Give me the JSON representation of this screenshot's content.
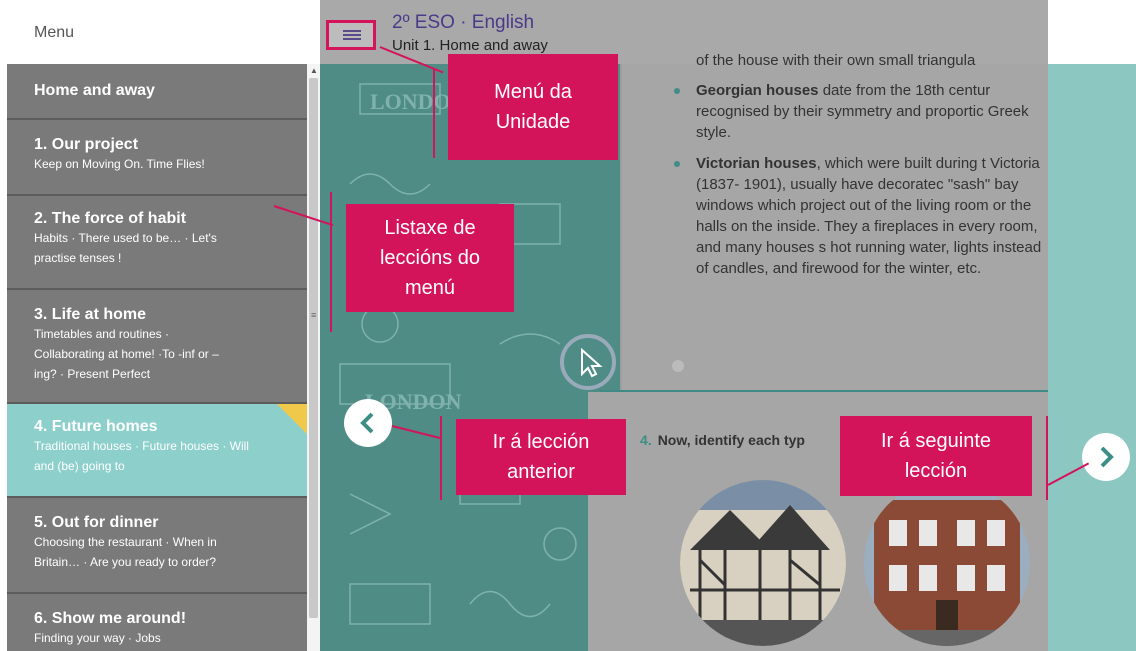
{
  "sidebar": {
    "menu_title": "Menu",
    "header_item": "Home and away",
    "items": [
      {
        "title": "1. Our project",
        "subtitle": "Keep on Moving On. Time Flies!"
      },
      {
        "title": "2. The force of habit",
        "subtitle": "Habits · There used to be… · Let's practise tenses !"
      },
      {
        "title": "3. Life at home",
        "subtitle": "Timetables and routines · Collaborating at home! ·To -inf or –ing? · Present Perfect"
      },
      {
        "title": "4. Future homes",
        "subtitle": "Traditional houses · Future houses · Will and (be) going to"
      },
      {
        "title": "5. Out for dinner",
        "subtitle": "Choosing the restaurant · When in Britain… · Are you ready to order?"
      },
      {
        "title": "6. Show me around!",
        "subtitle": "Finding your way · Jobs"
      }
    ],
    "active_index": 3
  },
  "header": {
    "title": "2º ESO · English",
    "subtitle": "Unit 1. Home and away"
  },
  "content": {
    "cut_line": "of the house with their own small triangula",
    "georgian_bold": "Georgian houses",
    "georgian_text": "date from the 18th centur recognised by their symmetry and proportic Greek style.",
    "victorian_bold": "Victorian houses",
    "victorian_text": ", which were built during t Victoria (1837- 1901), usually have decoratec \"sash\" bay windows which project out of the living room or the halls on the inside. They a fireplaces in every room, and many houses s hot running water, lights instead of candles, and firewood for the winter, etc.",
    "task_number": "4.",
    "task_text": "Now, identify each typ",
    "pattern_text": "LONDON"
  },
  "callouts": {
    "unit_menu": "Menú da\nUnidade",
    "lesson_list": "Listaxe de\nleccións do\nmenú",
    "prev": "Ir á lección\nanterior",
    "next": "Ir á seguinte\nlección"
  },
  "icons": {
    "menu": "hamburger-icon",
    "copy": "copy-icon",
    "search": "search-icon",
    "prev": "chevron-left-icon",
    "next": "chevron-right-icon",
    "cursor": "cursor-icon"
  },
  "colors": {
    "accent": "#d4145a",
    "teal": "#4f8c86",
    "active_item": "#8dcfcb",
    "menu_item": "#7a7a7a",
    "title_purple": "#4b3a8a"
  }
}
